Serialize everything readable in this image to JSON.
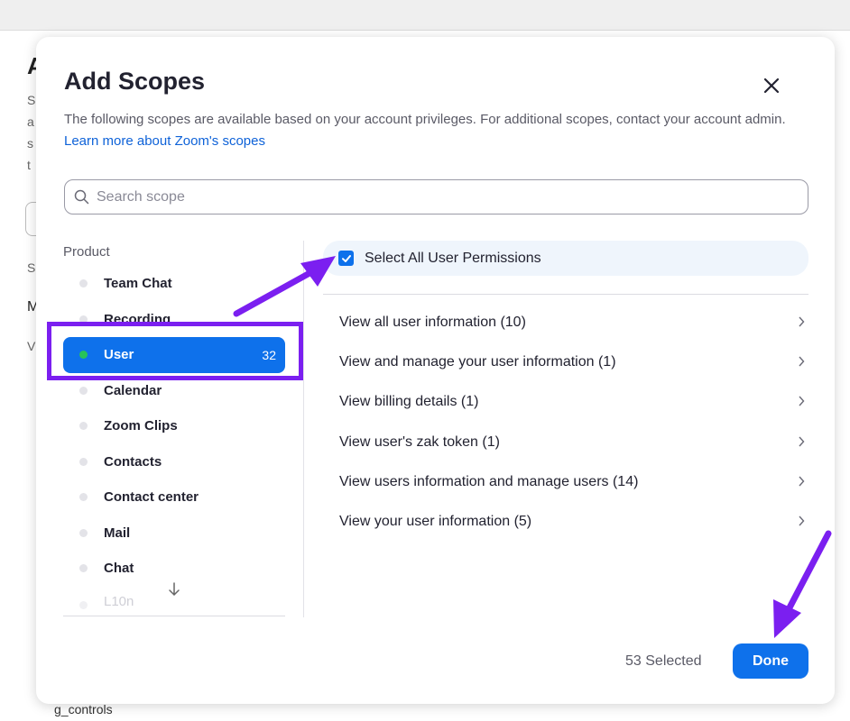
{
  "background": {
    "title_fragment": "A",
    "lines": [
      "S",
      "a",
      "s",
      "t",
      "S",
      "M",
      "V"
    ],
    "footer_text": "g_controls"
  },
  "modal": {
    "title": "Add Scopes",
    "close_icon": "close-icon",
    "description": "The following scopes are available based on your account privileges. For additional scopes, contact your account admin.",
    "learn_more_link": "Learn more about Zoom's scopes"
  },
  "search": {
    "placeholder": "Search scope",
    "icon": "search-icon"
  },
  "product": {
    "heading": "Product",
    "items": [
      {
        "label": "Team Chat"
      },
      {
        "label": "Recording"
      },
      {
        "label": "User",
        "count": "32",
        "active": true
      },
      {
        "label": "Calendar"
      },
      {
        "label": "Zoom Clips"
      },
      {
        "label": "Contacts"
      },
      {
        "label": "Contact center"
      },
      {
        "label": "Mail"
      },
      {
        "label": "Chat"
      },
      {
        "label": "L10n"
      }
    ],
    "scroll_icon": "arrow-down-icon"
  },
  "permissions": {
    "select_all_label": "Select All User Permissions",
    "select_all_checked": true,
    "items": [
      {
        "label": "View all user information (10)"
      },
      {
        "label": "View and manage your user information (1)"
      },
      {
        "label": "View billing details (1)"
      },
      {
        "label": "View user's zak token (1)"
      },
      {
        "label": "View users information and manage users (14)"
      },
      {
        "label": "View your user information (5)"
      }
    ]
  },
  "footer": {
    "selected_text": "53 Selected",
    "done_label": "Done"
  },
  "colors": {
    "accent": "#0e71eb",
    "link": "#0e62d8",
    "active_dot": "#27c25a",
    "annotation": "#7b1ff0"
  }
}
